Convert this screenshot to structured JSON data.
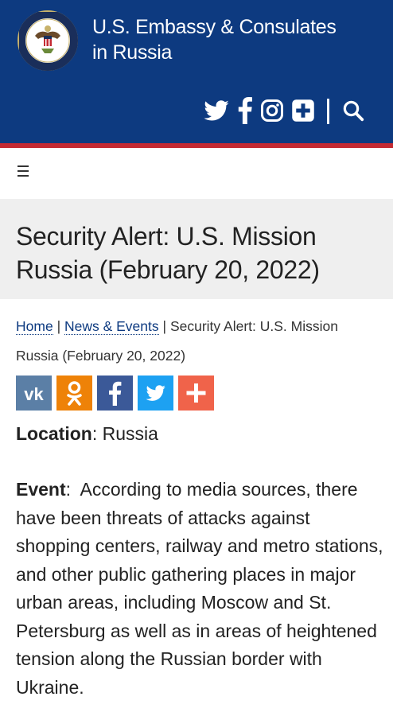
{
  "header": {
    "title_line1": "U.S. Embassy & Consulates",
    "title_line2": "in Russia",
    "brand_color": "#0d3a80",
    "stripe_color": "#c42a33",
    "social_icons": [
      "twitter-icon",
      "facebook-icon",
      "instagram-icon",
      "plus-square-icon",
      "search-icon"
    ]
  },
  "nav": {
    "menu_icon": "hamburger-icon"
  },
  "page": {
    "title": "Security Alert: U.S. Mission Russia (February 20, 2022)"
  },
  "breadcrumb": {
    "home": "Home",
    "news": "News & Events",
    "separator": "|",
    "current": "Security Alert: U.S. Mission Russia (February 20, 2022)"
  },
  "share": {
    "buttons": [
      {
        "icon": "vk-icon",
        "color": "#5b7fa6"
      },
      {
        "icon": "odnoklassniki-icon",
        "color": "#ee8208"
      },
      {
        "icon": "facebook-icon",
        "color": "#3b5998"
      },
      {
        "icon": "twitter-icon",
        "color": "#1da1f2"
      },
      {
        "icon": "plus-icon",
        "color": "#f0634a"
      }
    ]
  },
  "content": {
    "location_label": "Location",
    "location_value": ": Russia",
    "event_label": "Event",
    "event_text": ":  According to media sources, there have been threats of attacks against shopping centers, railway and metro stations, and other public gathering places in major urban areas, including Moscow and St. Petersburg as well as in areas of heightened tension along the Russian border with Ukraine."
  }
}
